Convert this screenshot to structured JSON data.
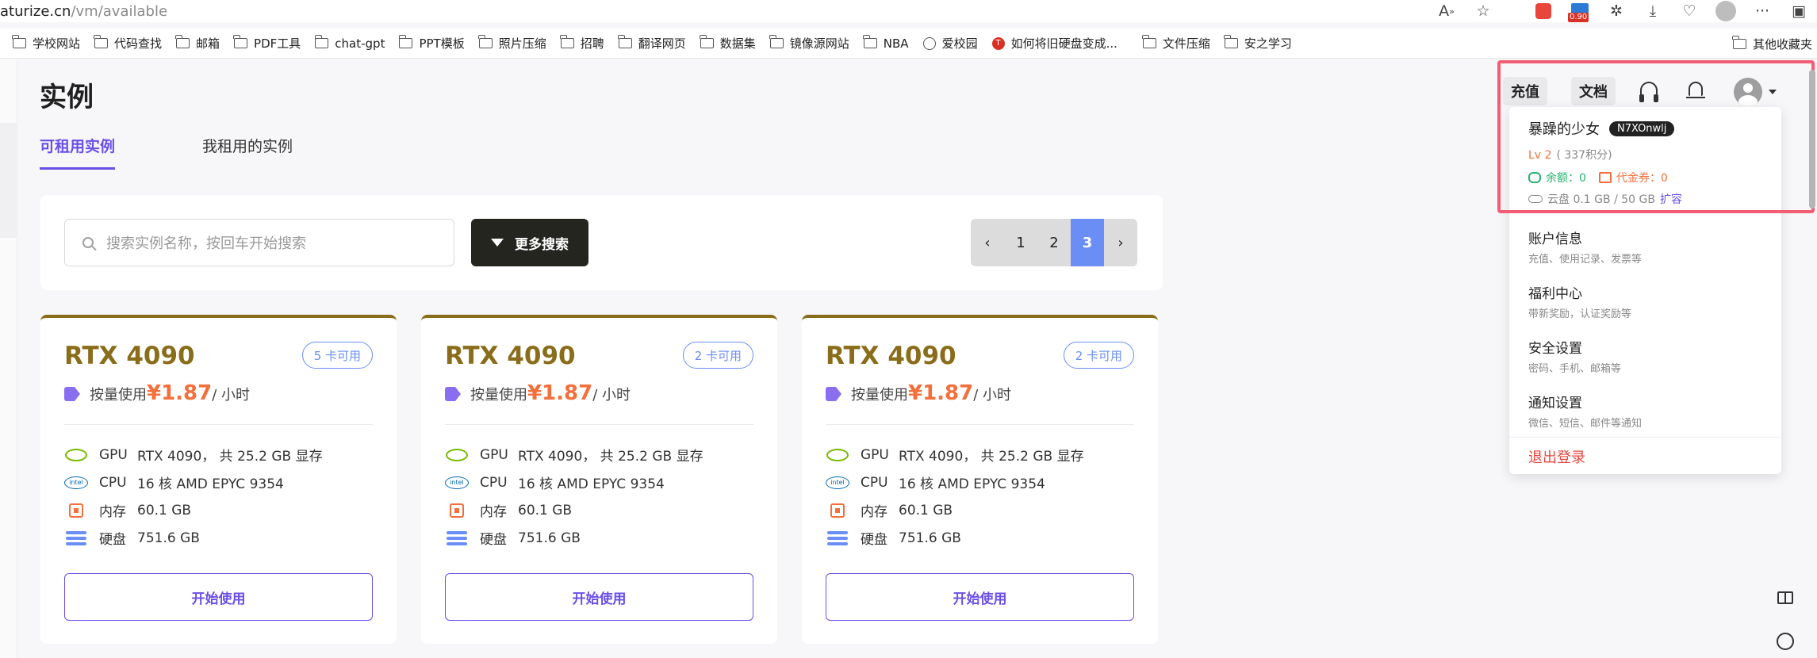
{
  "browser": {
    "url_host": "aturize.cn",
    "url_path": "/vm/available",
    "ext_badge": "0.90",
    "bookmarks": [
      {
        "label": "学校网站",
        "icon": "folder"
      },
      {
        "label": "代码查找",
        "icon": "folder"
      },
      {
        "label": "邮箱",
        "icon": "folder"
      },
      {
        "label": "PDF工具",
        "icon": "folder"
      },
      {
        "label": "chat-gpt",
        "icon": "folder"
      },
      {
        "label": "PPT模板",
        "icon": "folder"
      },
      {
        "label": "照片压缩",
        "icon": "folder"
      },
      {
        "label": "招聘",
        "icon": "folder"
      },
      {
        "label": "翻译网页",
        "icon": "folder"
      },
      {
        "label": "数据集",
        "icon": "folder"
      },
      {
        "label": "镜像源网站",
        "icon": "folder"
      },
      {
        "label": "NBA",
        "icon": "folder"
      },
      {
        "label": "爱校园",
        "icon": "globe"
      },
      {
        "label": "如何将旧硬盘变成...",
        "icon": "red"
      },
      {
        "label": "文件压缩",
        "icon": "folder"
      },
      {
        "label": "安之学习",
        "icon": "folder"
      }
    ],
    "other_bookmarks": "其他收藏夹"
  },
  "page": {
    "title": "实例",
    "tabs": [
      "可租用实例",
      "我租用的实例"
    ]
  },
  "search": {
    "placeholder": "搜索实例名称，按回车开始搜索",
    "more_label": "更多搜索",
    "pages": [
      "1",
      "2",
      "3"
    ],
    "current_page": "3"
  },
  "cards": [
    {
      "name": "RTX 4090",
      "avail": "5 卡可用",
      "price_prefix": "按量使用",
      "price": "¥1.87",
      "price_unit": "/ 小时",
      "gpu_k": "GPU",
      "gpu_v": "RTX 4090， 共 25.2 GB 显存",
      "cpu_k": "CPU",
      "cpu_v": "16 核 AMD EPYC 9354",
      "mem_k": "内存",
      "mem_v": "60.1 GB",
      "disk_k": "硬盘",
      "disk_v": "751.6 GB",
      "button": "开始使用"
    },
    {
      "name": "RTX 4090",
      "avail": "2 卡可用",
      "price_prefix": "按量使用",
      "price": "¥1.87",
      "price_unit": "/ 小时",
      "gpu_k": "GPU",
      "gpu_v": "RTX 4090， 共 25.2 GB 显存",
      "cpu_k": "CPU",
      "cpu_v": "16 核 AMD EPYC 9354",
      "mem_k": "内存",
      "mem_v": "60.1 GB",
      "disk_k": "硬盘",
      "disk_v": "751.6 GB",
      "button": "开始使用"
    },
    {
      "name": "RTX 4090",
      "avail": "2 卡可用",
      "price_prefix": "按量使用",
      "price": "¥1.87",
      "price_unit": "/ 小时",
      "gpu_k": "GPU",
      "gpu_v": "RTX 4090， 共 25.2 GB 显存",
      "cpu_k": "CPU",
      "cpu_v": "16 核 AMD EPYC 9354",
      "mem_k": "内存",
      "mem_v": "60.1 GB",
      "disk_k": "硬盘",
      "disk_v": "751.6 GB",
      "button": "开始使用"
    }
  ],
  "header": {
    "recharge": "充值",
    "docs": "文档"
  },
  "dropdown": {
    "username": "暴躁的少女",
    "uid": "N7XOnwlj",
    "level": "Lv 2",
    "points": "( 337积分)",
    "balance": "余额：0",
    "voucher": "代金券：0",
    "cloud": "云盘 0.1 GB / 50 GB",
    "cloud_expand": "扩容",
    "items": [
      {
        "title": "账户信息",
        "sub": "充值、使用记录、发票等"
      },
      {
        "title": "福利中心",
        "sub": "带新奖励，认证奖励等"
      },
      {
        "title": "安全设置",
        "sub": "密码、手机、邮箱等"
      },
      {
        "title": "通知设置",
        "sub": "微信、短信、邮件等通知"
      }
    ],
    "logout": "退出登录"
  },
  "colors": {
    "accent": "#6a4ee8",
    "price": "#f36f3b",
    "card_title": "#8a6d1a",
    "page_active": "#6a8ef5",
    "highlight": "#f25d74"
  }
}
